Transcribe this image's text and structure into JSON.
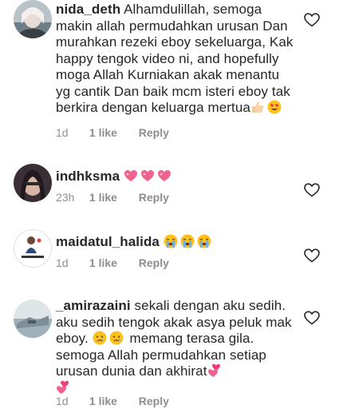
{
  "comments": [
    {
      "username": "nida_deth",
      "text": "Alhamdulillah, semoga makin allah permudahkan urusan Dan murahkan rezeki eboy sekeluarga,  Kak happy tengok video ni, and hopefully moga Allah Kurniakan akak menantu yg cantik Dan baik mcm isteri eboy tak berkira dengan keluarga mertua",
      "emojis": [
        "thumbs-up-emoji",
        "heart-eyes-emoji"
      ],
      "time": "1d",
      "likes": "1 like",
      "reply": "Reply"
    },
    {
      "username": "indhksma",
      "text": "",
      "emojis": [
        "sparkling-heart-emoji",
        "sparkling-heart-emoji",
        "sparkling-heart-emoji"
      ],
      "time": "23h",
      "likes": "1 like",
      "reply": "Reply"
    },
    {
      "username": "maidatul_halida",
      "text": "",
      "emojis": [
        "loudly-crying-emoji",
        "loudly-crying-emoji",
        "loudly-crying-emoji"
      ],
      "time": "1d",
      "likes": "1 like",
      "reply": "Reply"
    },
    {
      "username": "_amirazaini",
      "text": "sekali dengan aku sedih. aku sedih tengok akak asya peluk mak eboy.",
      "text_after": "memang terasa gila. semoga Allah permudahkan setiap urusan dunia dan akhirat",
      "emojis_mid": [
        "crying-face-emoji",
        "crying-face-emoji"
      ],
      "emojis_end": [
        "two-hearts-emoji",
        "two-hearts-emoji"
      ],
      "time": "1d",
      "likes": "1 like",
      "reply": "Reply"
    }
  ],
  "colors": {
    "text": "#262626",
    "meta": "#8e8e8e",
    "heart_outline": "#262626"
  }
}
